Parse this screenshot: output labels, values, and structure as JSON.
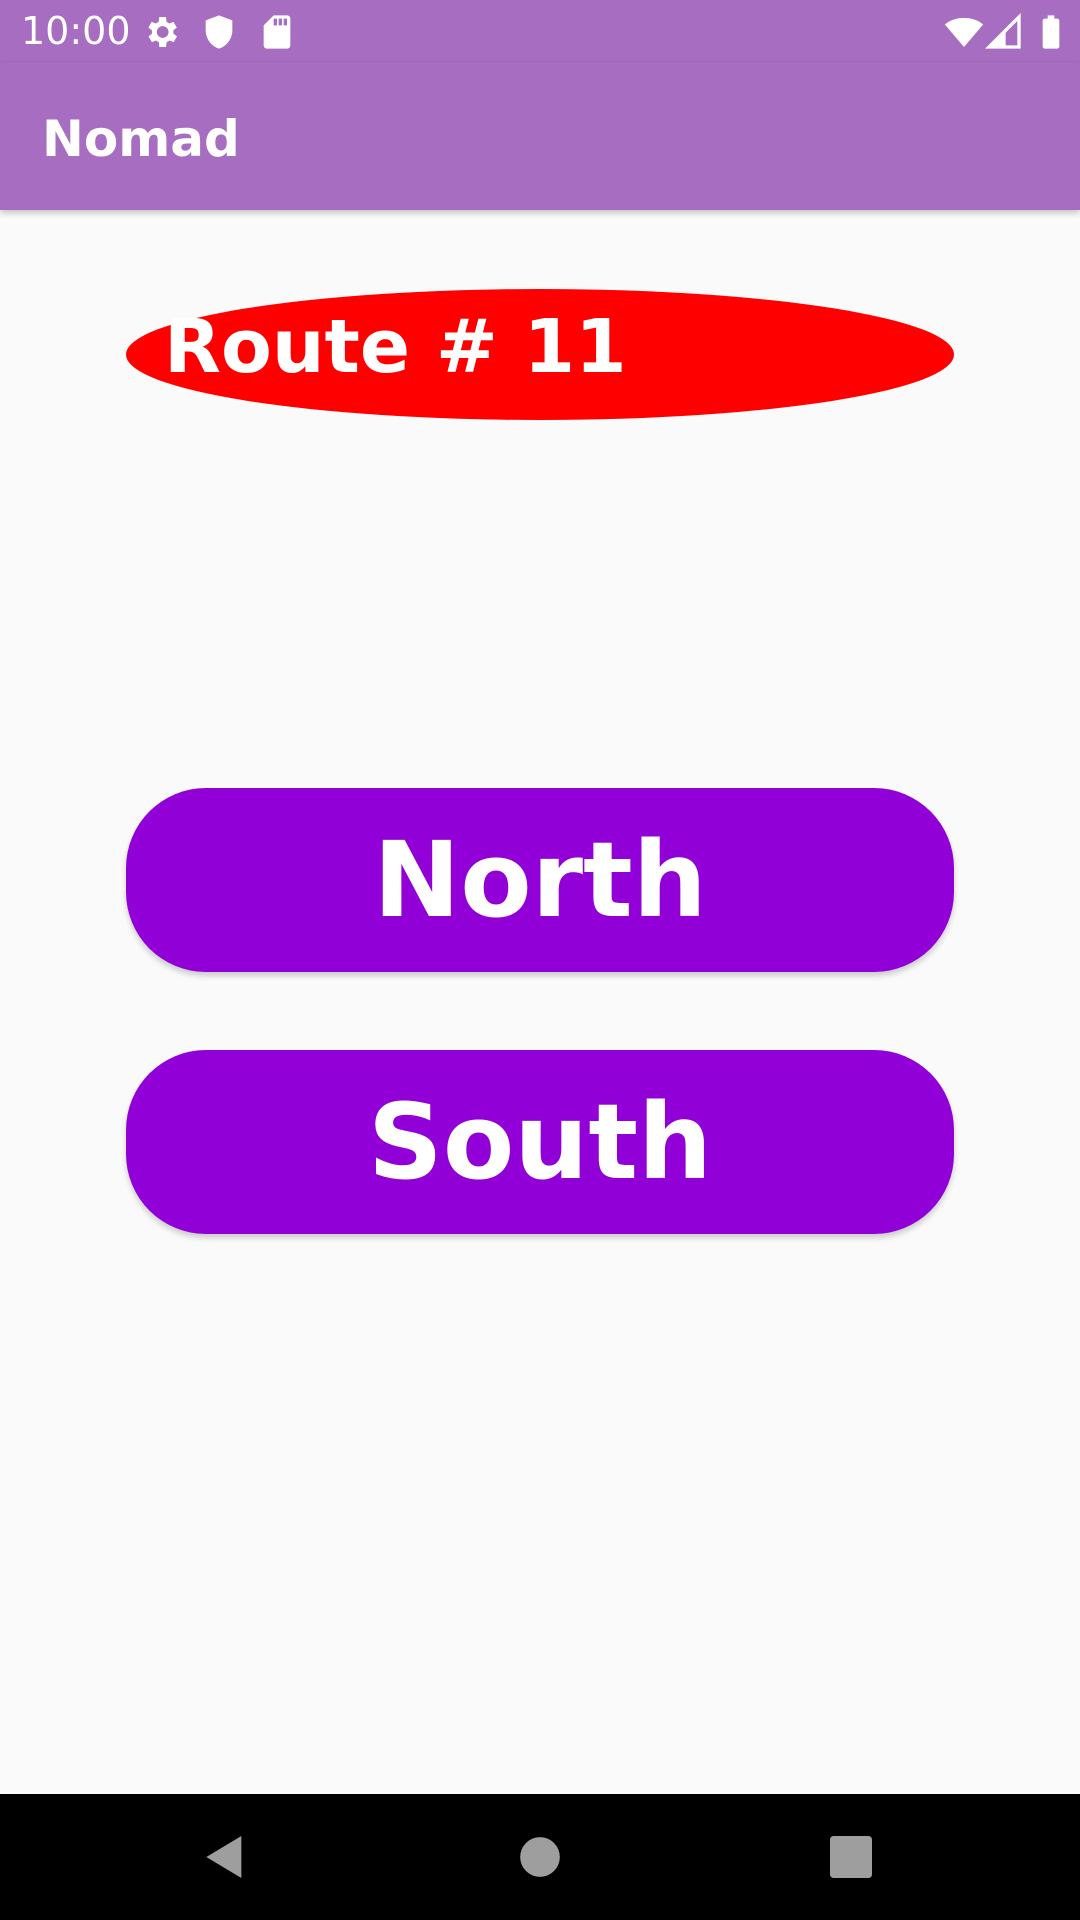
{
  "status_bar": {
    "time": "10:00",
    "left_icons": [
      "gear-icon",
      "shield-icon",
      "sd-card-icon"
    ],
    "right_icons": [
      "wifi-icon",
      "cell-signal-icon",
      "battery-icon"
    ]
  },
  "app_bar": {
    "title": "Nomad"
  },
  "route": {
    "label": "Route # 11"
  },
  "directions": {
    "north_label": "North",
    "south_label": "South"
  },
  "nav_bar": {
    "icons": [
      "back-icon",
      "home-icon",
      "recents-icon"
    ]
  },
  "colors": {
    "app_bar": "#a66dc1",
    "route_badge": "#ff0000",
    "button": "#9100d6",
    "background": "#fafafa",
    "nav_bar": "#000000"
  }
}
